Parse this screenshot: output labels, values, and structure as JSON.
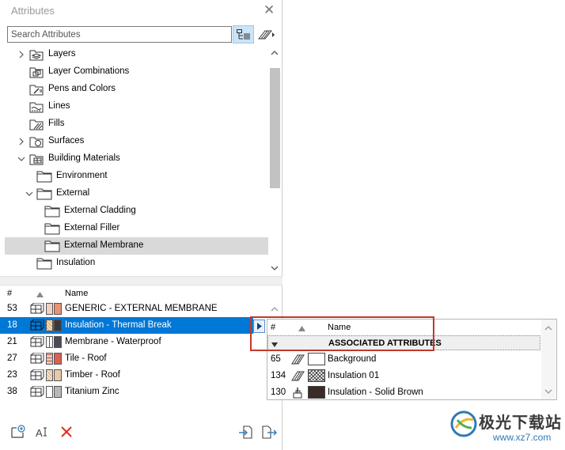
{
  "panel": {
    "title": "Attributes",
    "close_glyph": "✕"
  },
  "search": {
    "placeholder": "Search Attributes",
    "value": ""
  },
  "tree": {
    "items": [
      {
        "label": "Layers",
        "indent": 0,
        "expander": "collapsed",
        "icon": "layers-icon",
        "selected": false
      },
      {
        "label": "Layer Combinations",
        "indent": 0,
        "expander": "none",
        "icon": "layer-combinations-icon",
        "selected": false
      },
      {
        "label": "Pens and Colors",
        "indent": 0,
        "expander": "none",
        "icon": "pens-colors-icon",
        "selected": false
      },
      {
        "label": "Lines",
        "indent": 0,
        "expander": "none",
        "icon": "lines-icon",
        "selected": false
      },
      {
        "label": "Fills",
        "indent": 0,
        "expander": "none",
        "icon": "fills-icon",
        "selected": false
      },
      {
        "label": "Surfaces",
        "indent": 0,
        "expander": "collapsed",
        "icon": "surfaces-icon",
        "selected": false
      },
      {
        "label": "Building Materials",
        "indent": 0,
        "expander": "expanded",
        "icon": "building-materials-icon",
        "selected": false
      },
      {
        "label": "Environment",
        "indent": 1,
        "expander": "none",
        "icon": "folder-icon",
        "selected": false
      },
      {
        "label": "External",
        "indent": 1,
        "expander": "expanded",
        "icon": "folder-icon",
        "selected": false
      },
      {
        "label": "External Cladding",
        "indent": 2,
        "expander": "none",
        "icon": "folder-icon",
        "selected": false
      },
      {
        "label": "External Filler",
        "indent": 2,
        "expander": "none",
        "icon": "folder-icon",
        "selected": false
      },
      {
        "label": "External Membrane",
        "indent": 2,
        "expander": "none",
        "icon": "folder-icon",
        "selected": true
      },
      {
        "label": "Insulation",
        "indent": 1,
        "expander": "none",
        "icon": "folder-icon",
        "selected": false
      }
    ]
  },
  "list": {
    "headers": {
      "num": "#",
      "name": "Name"
    },
    "rows": [
      {
        "num": "53",
        "name": "GENERIC - EXTERNAL MEMBRANE",
        "color1": "#f1d0c4",
        "color2": "#e89174",
        "selected": false
      },
      {
        "num": "18",
        "name": "Insulation - Thermal Break",
        "color1": "#f4ddb8",
        "color2": "#3a3a3a",
        "selected": true
      },
      {
        "num": "21",
        "name": "Membrane - Waterproof",
        "color1": "#ffffff",
        "color2": "#4b4b57",
        "selected": false
      },
      {
        "num": "27",
        "name": "Tile - Roof",
        "color1": "#efc7bc",
        "color2": "#d96150",
        "selected": false
      },
      {
        "num": "23",
        "name": "Timber - Roof",
        "color1": "#f7e5d0",
        "color2": "#e8c9aa",
        "selected": false
      },
      {
        "num": "38",
        "name": "Titanium Zinc",
        "color1": "#ffffff",
        "color2": "#b8b8b8",
        "selected": false
      }
    ]
  },
  "popup": {
    "headers": {
      "num": "#",
      "name": "Name"
    },
    "group_label": "ASSOCIATED ATTRIBUTES",
    "rows": [
      {
        "num": "65",
        "name": "Background",
        "icon": "fill-icon",
        "swatch": "#ffffff"
      },
      {
        "num": "134",
        "name": "Insulation 01",
        "icon": "fill-icon",
        "swatch": "pattern"
      },
      {
        "num": "130",
        "name": "Insulation - Solid Brown",
        "icon": "surface-icon",
        "swatch": "#3b2b26"
      }
    ]
  },
  "watermark": {
    "title": "极光下载站",
    "url": "www.xz7.com"
  },
  "colors": {
    "selection": "#0078d7",
    "tree_selection": "#d9d9d9",
    "highlight_box": "#c0392b",
    "delete_red": "#e0301e",
    "accent_blue": "#2f7ab8"
  }
}
